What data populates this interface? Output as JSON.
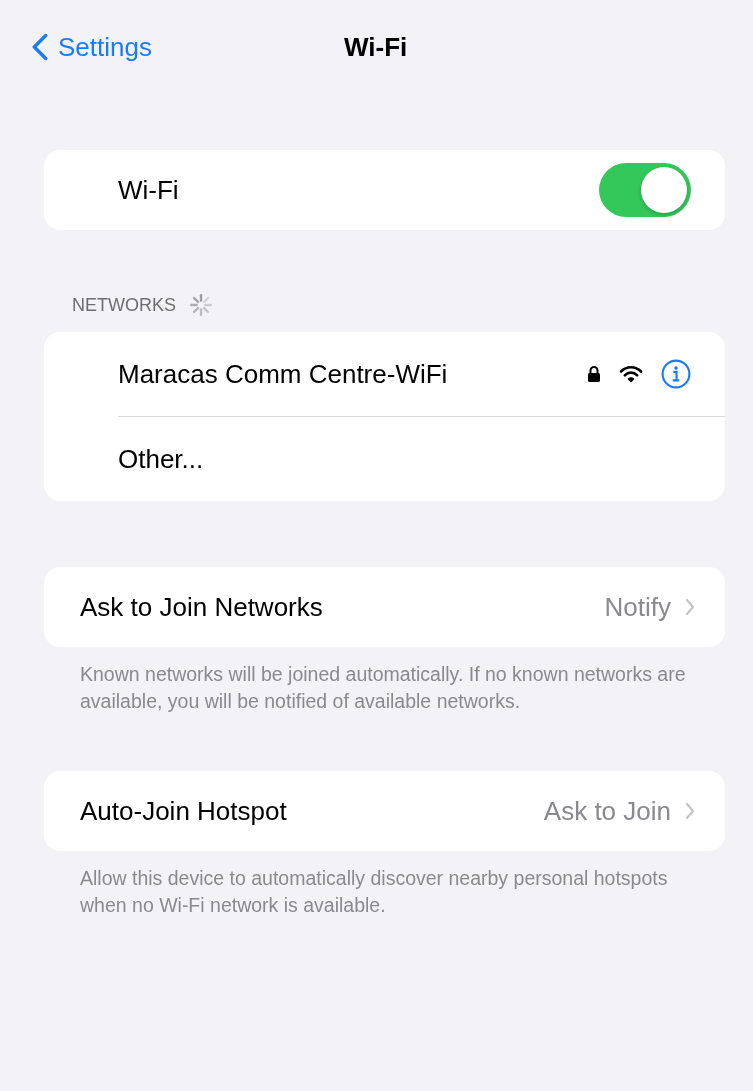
{
  "nav": {
    "back_label": "Settings",
    "title": "Wi-Fi"
  },
  "wifi": {
    "label": "Wi-Fi",
    "on": true
  },
  "networks": {
    "header": "NETWORKS",
    "scanning": true,
    "items": [
      {
        "kind": "network",
        "name": "Maracas Comm Centre-WiFi",
        "locked": true
      },
      {
        "kind": "other",
        "name": "Other..."
      }
    ]
  },
  "settings": [
    {
      "label": "Ask to Join Networks",
      "value": "Notify",
      "footer": "Known networks will be joined automatically. If no known networks are available, you will be notified of available networks."
    },
    {
      "label": "Auto-Join Hotspot",
      "value": "Ask to Join",
      "footer": "Allow this device to automatically discover nearby personal hotspots when no Wi-Fi network is available."
    }
  ]
}
